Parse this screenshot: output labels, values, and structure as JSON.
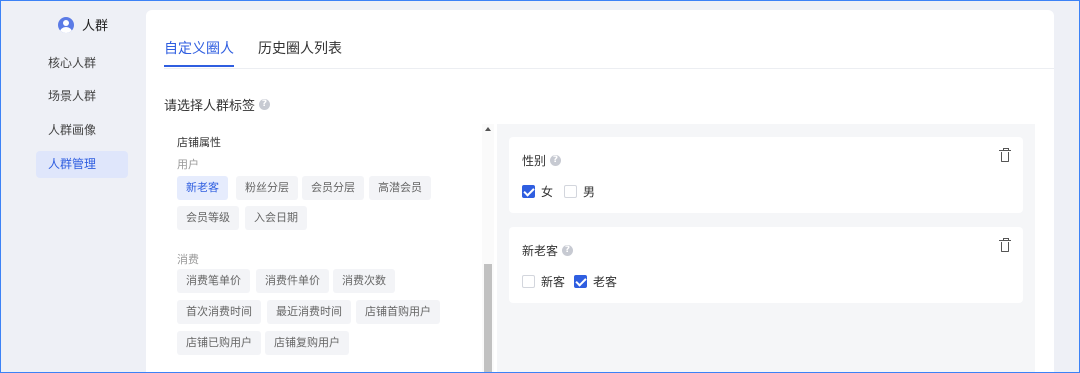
{
  "sidebar": {
    "title": "人群",
    "items": [
      {
        "label": "核心人群"
      },
      {
        "label": "场景人群"
      },
      {
        "label": "人群画像"
      },
      {
        "label": "人群管理"
      }
    ]
  },
  "tabs": [
    {
      "label": "自定义圈人"
    },
    {
      "label": "历史圈人列表"
    }
  ],
  "section_title": "请选择人群标签",
  "left": {
    "group_title": "店铺属性",
    "categories": [
      {
        "name": "用户",
        "tags": [
          "新老客",
          "粉丝分层",
          "会员分层",
          "高潜会员",
          "会员等级",
          "入会日期"
        ]
      },
      {
        "name": "消费",
        "tags": [
          "消费笔单价",
          "消费件单价",
          "消费次数",
          "首次消费时间",
          "最近消费时间",
          "店铺首购用户",
          "店铺已购用户",
          "店铺复购用户"
        ]
      }
    ],
    "selected_tag": "新老客"
  },
  "right": {
    "cards": [
      {
        "title": "性别",
        "options": [
          {
            "label": "女",
            "checked": true
          },
          {
            "label": "男",
            "checked": false
          }
        ]
      },
      {
        "title": "新老客",
        "options": [
          {
            "label": "新客",
            "checked": false
          },
          {
            "label": "老客",
            "checked": true
          }
        ]
      }
    ]
  },
  "colors": {
    "accent": "#2f5ee0",
    "background": "#eef0f6",
    "frame": "#3c82f6"
  }
}
